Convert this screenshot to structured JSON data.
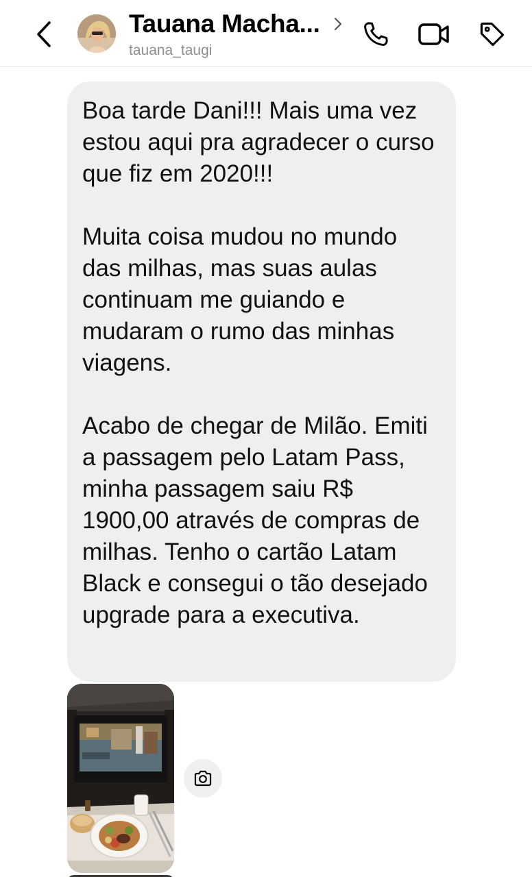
{
  "header": {
    "contact_name": "Tauana Macha...",
    "username": "tauana_taugi",
    "icons": [
      "back-chevron-icon",
      "phone-icon",
      "video-camera-icon",
      "tag-icon"
    ]
  },
  "message": {
    "paragraphs": [
      "Boa tarde Dani!!! Mais uma vez estou aqui pra agradecer o curso que fiz em 2020!!!",
      "Muita coisa mudou no mundo das milhas, mas suas aulas continuam me guiando e mudaram o rumo das minhas viagens.",
      "Acabo de chegar de Milão. Emiti a passagem pelo Latam Pass, minha passagem saiu R$ 1900,00 através de compras de milhas. Tenho o cartão Latam Black e consegui o tão desejado upgrade para a executiva."
    ]
  },
  "attachment": {
    "icon": "camera-icon"
  },
  "colors": {
    "bubble_bg": "#efeff2",
    "username_gray": "#8e8e8e"
  }
}
